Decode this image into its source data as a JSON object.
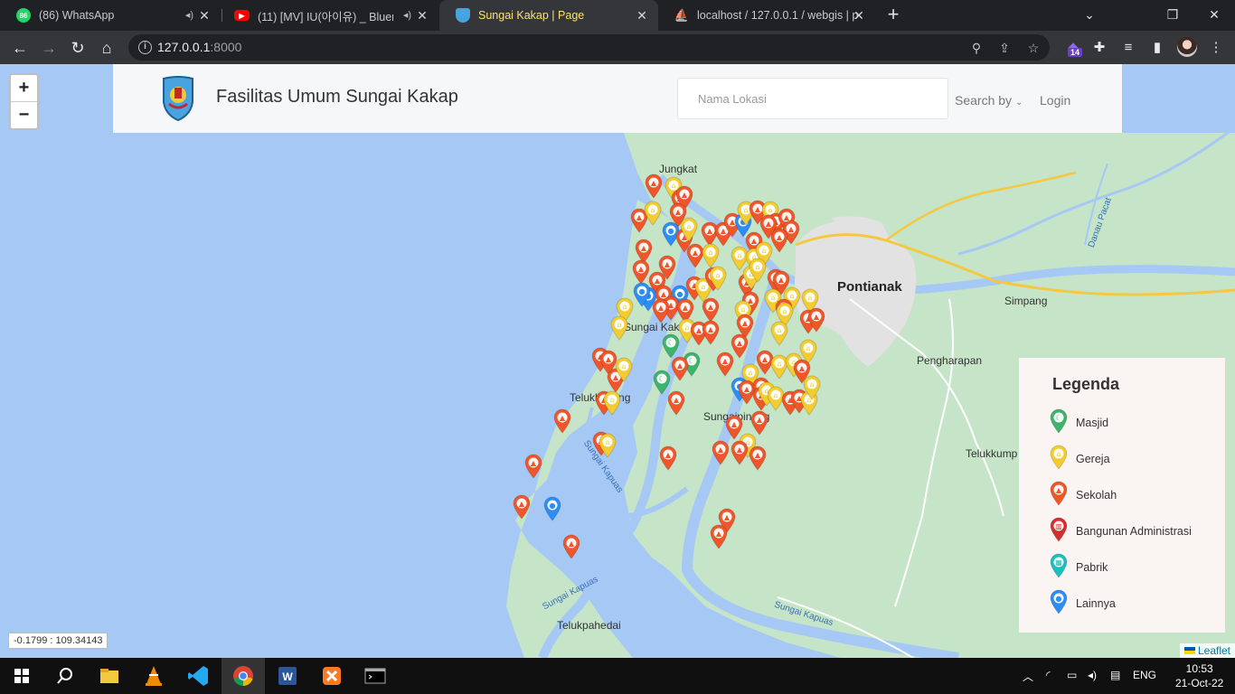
{
  "browser": {
    "tabs": [
      {
        "title": "(86) WhatsApp",
        "badge": "86",
        "favicon": "whatsapp-icon",
        "color": "#25d366",
        "audio": true
      },
      {
        "title": "(11) [MV] IU(아이유) _ Bluem",
        "favicon": "youtube-icon",
        "color": "#ff0000",
        "audio": true
      },
      {
        "title": "Sungai Kakap | Page",
        "favicon": "site-logo-icon",
        "color": "#4aa3df",
        "active": true
      },
      {
        "title": "localhost / 127.0.0.1 / webgis | ph",
        "favicon": "phpmyadmin-icon",
        "color": "#f29111"
      }
    ],
    "url_host": "127.0.0.1",
    "url_port": ":8000",
    "extension_badge": "14"
  },
  "header": {
    "title": "Fasilitas Umum Sungai Kakap",
    "search_placeholder": "Nama Lokasi",
    "search_by": "Search by",
    "login": "Login"
  },
  "map": {
    "zoom_in": "+",
    "zoom_out": "−",
    "coordinates": "-0.1799 : 109.34143",
    "attribution": "Leaflet",
    "labels": {
      "jungkat": "Jungkat",
      "pontianak": "Pontianak",
      "simpang": "Simpang",
      "pengharapan": "Pengharapan",
      "sungai_kakap": "Sungai Kakap",
      "teluk_kapuas": "Telukkepang",
      "sungai_pinang": "Sungaipinang",
      "telukkump": "Telukkump",
      "telukpahedai": "Telukpahedai",
      "sungai_kapuas": "Sungai Kapuas",
      "danau_pacat": "Danau Pacat"
    },
    "colors": {
      "water": "#a6c8f5",
      "land": "#c5e4c8",
      "city": "#e2e2e2",
      "road": "#f5c842"
    }
  },
  "legend": {
    "title": "Legenda",
    "items": [
      {
        "label": "Masjid",
        "color": "#3db36b",
        "icon": "mosque-icon"
      },
      {
        "label": "Gereja",
        "color": "#f2cc30",
        "icon": "church-icon"
      },
      {
        "label": "Sekolah",
        "color": "#f0562a",
        "icon": "school-icon"
      },
      {
        "label": "Bangunan Administrasi",
        "color": "#d32f2f",
        "icon": "government-building-icon"
      },
      {
        "label": "Pabrik",
        "color": "#1bbfbf",
        "icon": "factory-icon"
      },
      {
        "label": "Lainnya",
        "color": "#2c8df4",
        "icon": "pin-icon"
      }
    ]
  },
  "taskbar": {
    "language": "ENG",
    "time": "10:53",
    "date": "21-Oct-22"
  }
}
